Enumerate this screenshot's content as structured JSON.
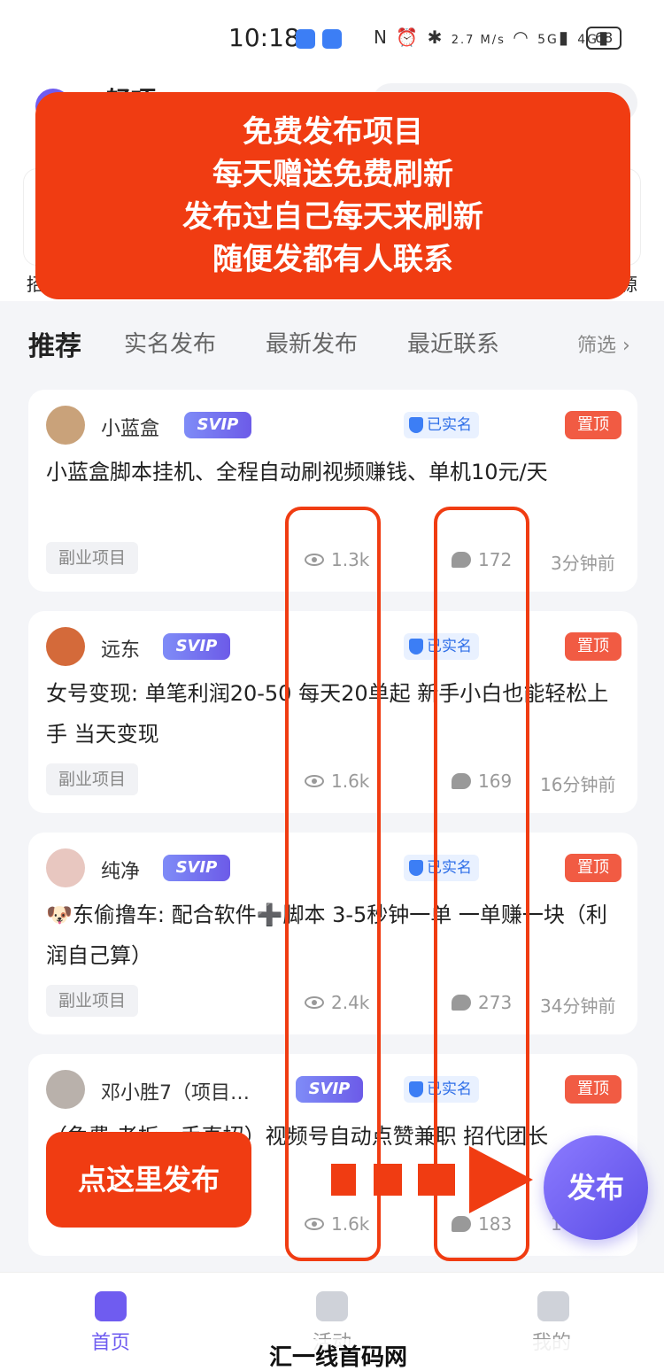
{
  "status_bar": {
    "time": "10:18",
    "speed": "2.7 M/s",
    "signal1": "5G",
    "signal2": "4G",
    "battery": "68"
  },
  "header": {
    "title": "轻项",
    "cut_left": "招",
    "cut_right": "源"
  },
  "promo": {
    "lines": [
      "免费发布项目",
      "每天赠送免费刷新",
      "发布过自己每天来刷新",
      "随便发都有人联系"
    ]
  },
  "tabs": {
    "items": [
      "推荐",
      "实名发布",
      "最新发布",
      "最近联系"
    ],
    "filter": "筛选"
  },
  "cards": [
    {
      "user": "小蓝盒",
      "svip": "SVIP",
      "verified": "已实名",
      "pin": "置顶",
      "title": "小蓝盒脚本挂机、全程自动刷视频赚钱、单机10元/天",
      "tag": "副业项目",
      "views": "1.3k",
      "comments": "172",
      "time": "3分钟前"
    },
    {
      "user": "远东",
      "svip": "SVIP",
      "verified": "已实名",
      "pin": "置顶",
      "title": "女号变现: 单笔利润20-50 每天20单起 新手小白也能轻松上手 当天变现",
      "tag": "副业项目",
      "views": "1.6k",
      "comments": "169",
      "time": "16分钟前"
    },
    {
      "user": "纯净",
      "svip": "SVIP",
      "verified": "已实名",
      "pin": "置顶",
      "title": "🐶东偷撸车: 配合软件➕脚本 3-5秒钟一单 一单赚一块（利润自己算）",
      "tag": "副业项目",
      "views": "2.4k",
      "comments": "273",
      "time": "34分钟前"
    },
    {
      "user": "邓小胜7（项目…",
      "svip": "SVIP",
      "verified": "已实名",
      "pin": "置顶",
      "title": "（免费 老板一手直招）视频号自动点赞兼职 招代团长",
      "tag": "",
      "views": "1.6k",
      "comments": "183",
      "time": "1"
    }
  ],
  "overlay": {
    "callout": "点这里发布",
    "fab": "发布"
  },
  "bottom_nav": {
    "items": [
      "首页",
      "活动",
      "我的"
    ]
  },
  "watermark": "汇一线首码网 www.huiyixian.com",
  "colors": {
    "accent": "#6f5cf0",
    "promo": "#f03c12",
    "pin": "#f15b43"
  }
}
